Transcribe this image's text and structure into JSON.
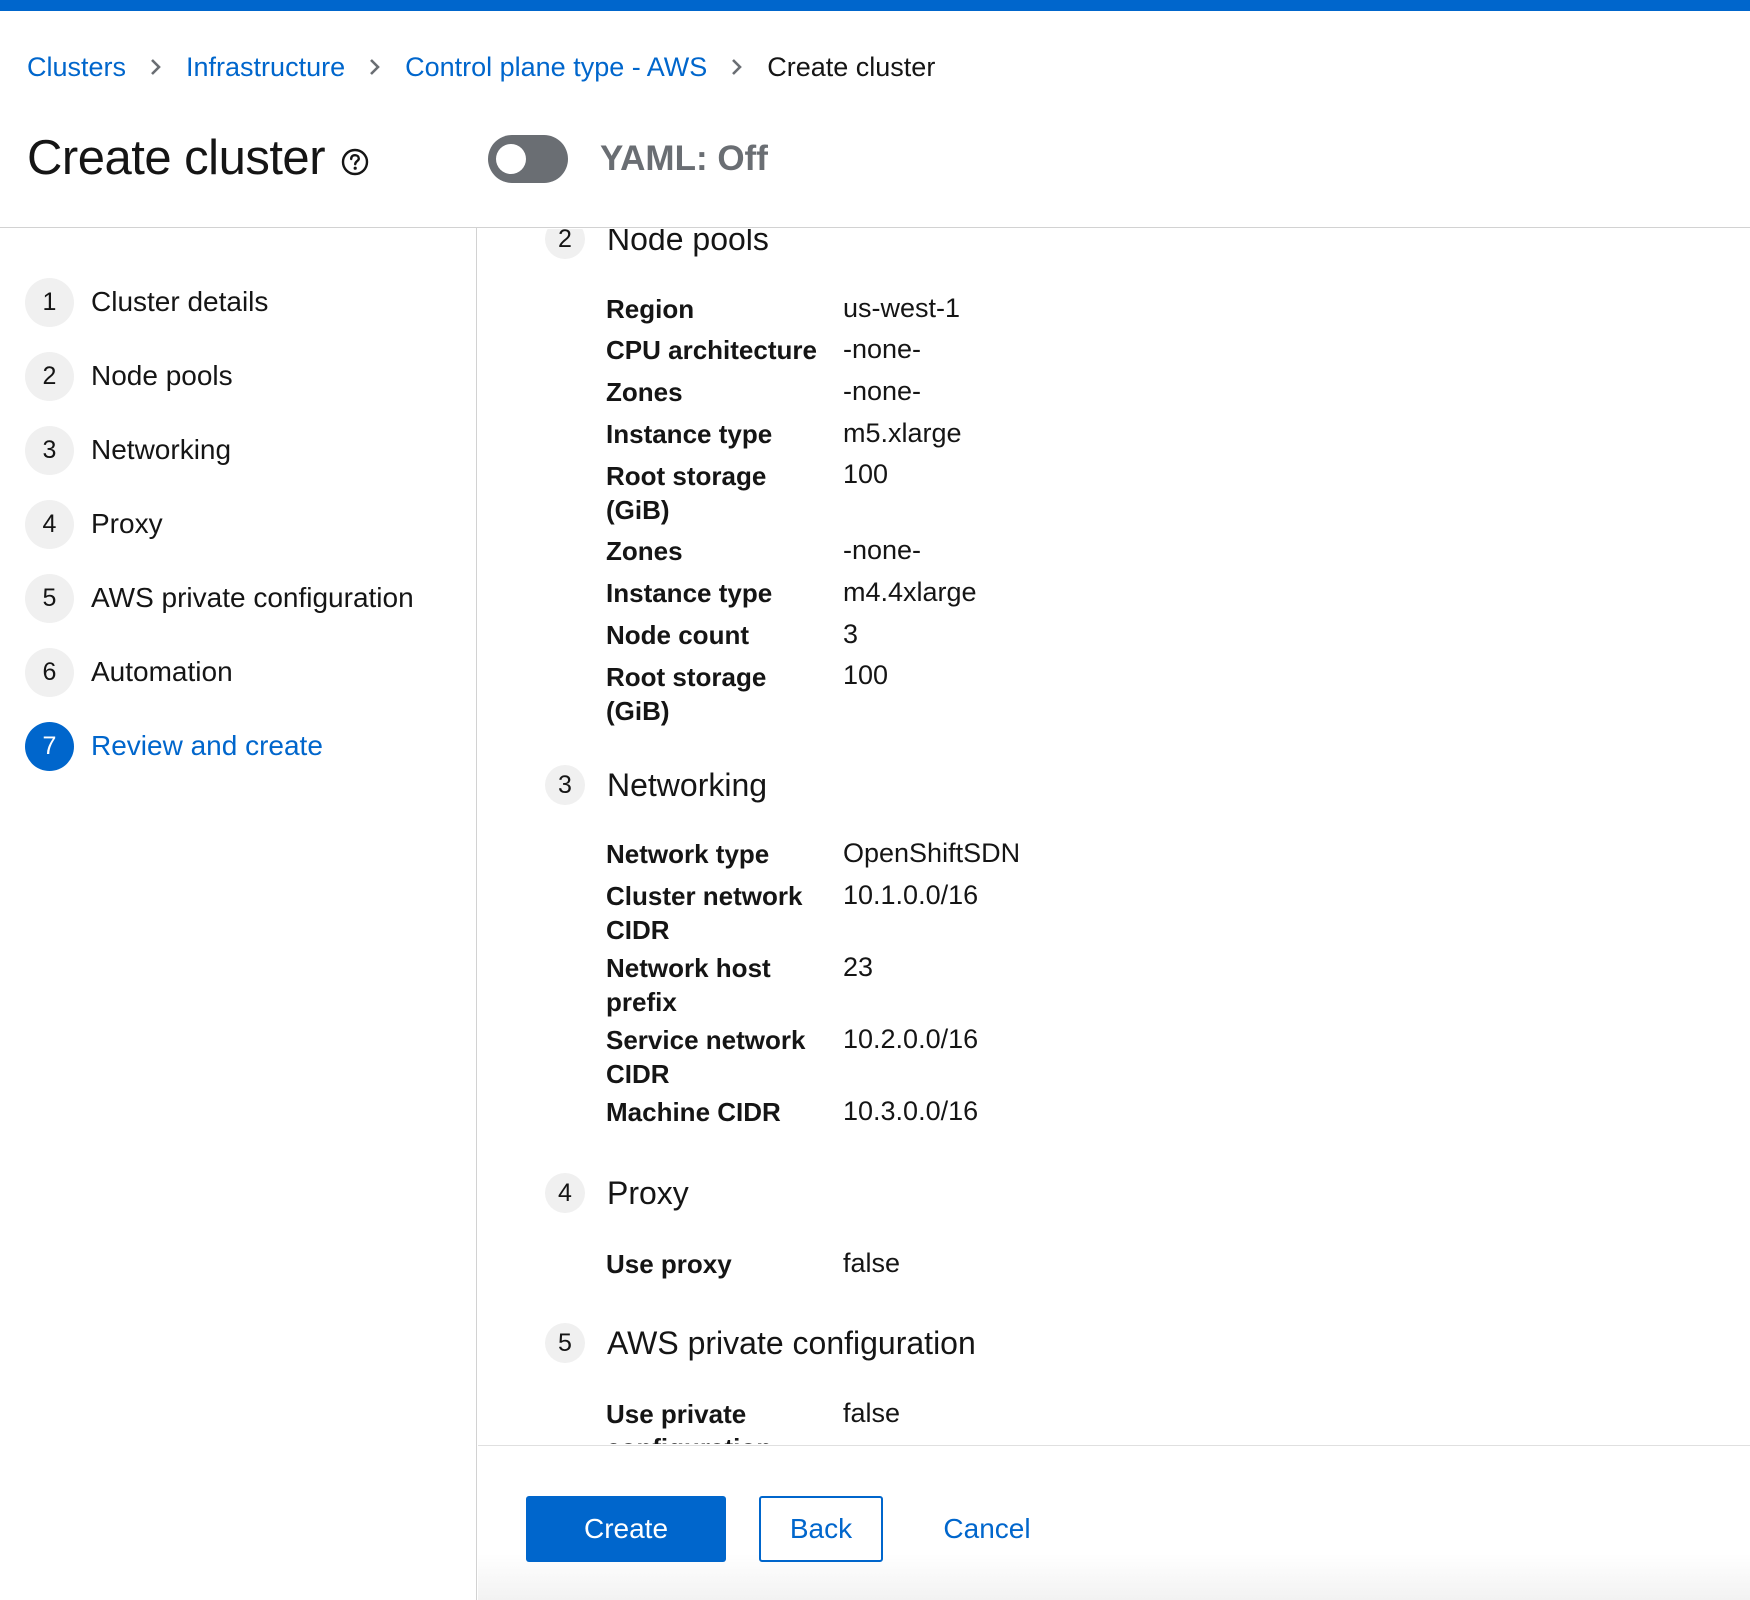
{
  "colors": {
    "accent": "#0066cc",
    "toggle_off": "#6a6e73",
    "step_bg": "#f0f0f0"
  },
  "breadcrumb": {
    "links": [
      "Clusters",
      "Infrastructure",
      "Control plane type - AWS"
    ],
    "current": "Create cluster",
    "separator_icon": "chevron-right-icon"
  },
  "header": {
    "title": "Create cluster",
    "help_icon": "question-circle-icon",
    "yaml_label": "YAML: Off",
    "yaml_on": false
  },
  "wizard_nav": {
    "items": [
      {
        "num": "1",
        "label": "Cluster details"
      },
      {
        "num": "2",
        "label": "Node pools"
      },
      {
        "num": "3",
        "label": "Networking"
      },
      {
        "num": "4",
        "label": "Proxy"
      },
      {
        "num": "5",
        "label": "AWS private configuration"
      },
      {
        "num": "6",
        "label": "Automation"
      },
      {
        "num": "7",
        "label": "Review and create"
      }
    ],
    "active": "7"
  },
  "review": {
    "node_pools": {
      "num": "2",
      "title": "Node pools",
      "rows": [
        {
          "term": "Region",
          "value": "us-west-1"
        },
        {
          "term": "CPU architecture",
          "value": "-none-"
        },
        {
          "term": "Zones",
          "value": "-none-"
        },
        {
          "term": "Instance type",
          "value": "m5.xlarge"
        },
        {
          "term": "Root storage (GiB)",
          "value": "100"
        },
        {
          "term": "Zones",
          "value": "-none-"
        },
        {
          "term": "Instance type",
          "value": "m4.4xlarge"
        },
        {
          "term": "Node count",
          "value": "3"
        },
        {
          "term": "Root storage (GiB)",
          "value": "100"
        }
      ]
    },
    "networking": {
      "num": "3",
      "title": "Networking",
      "rows": [
        {
          "term": "Network type",
          "value": "OpenShiftSDN"
        },
        {
          "term": "Cluster network CIDR",
          "value": "10.1.0.0/16"
        },
        {
          "term": "Network host prefix",
          "value": "23"
        },
        {
          "term": "Service network CIDR",
          "value": "10.2.0.0/16"
        },
        {
          "term": "Machine CIDR",
          "value": "10.3.0.0/16"
        }
      ]
    },
    "proxy": {
      "num": "4",
      "title": "Proxy",
      "rows": [
        {
          "term": "Use proxy",
          "value": "false"
        }
      ]
    },
    "aws_private": {
      "num": "5",
      "title": "AWS private configuration",
      "rows": [
        {
          "term": "Use private configuration",
          "value": "false"
        }
      ]
    }
  },
  "footer": {
    "create": "Create",
    "back": "Back",
    "cancel": "Cancel"
  }
}
